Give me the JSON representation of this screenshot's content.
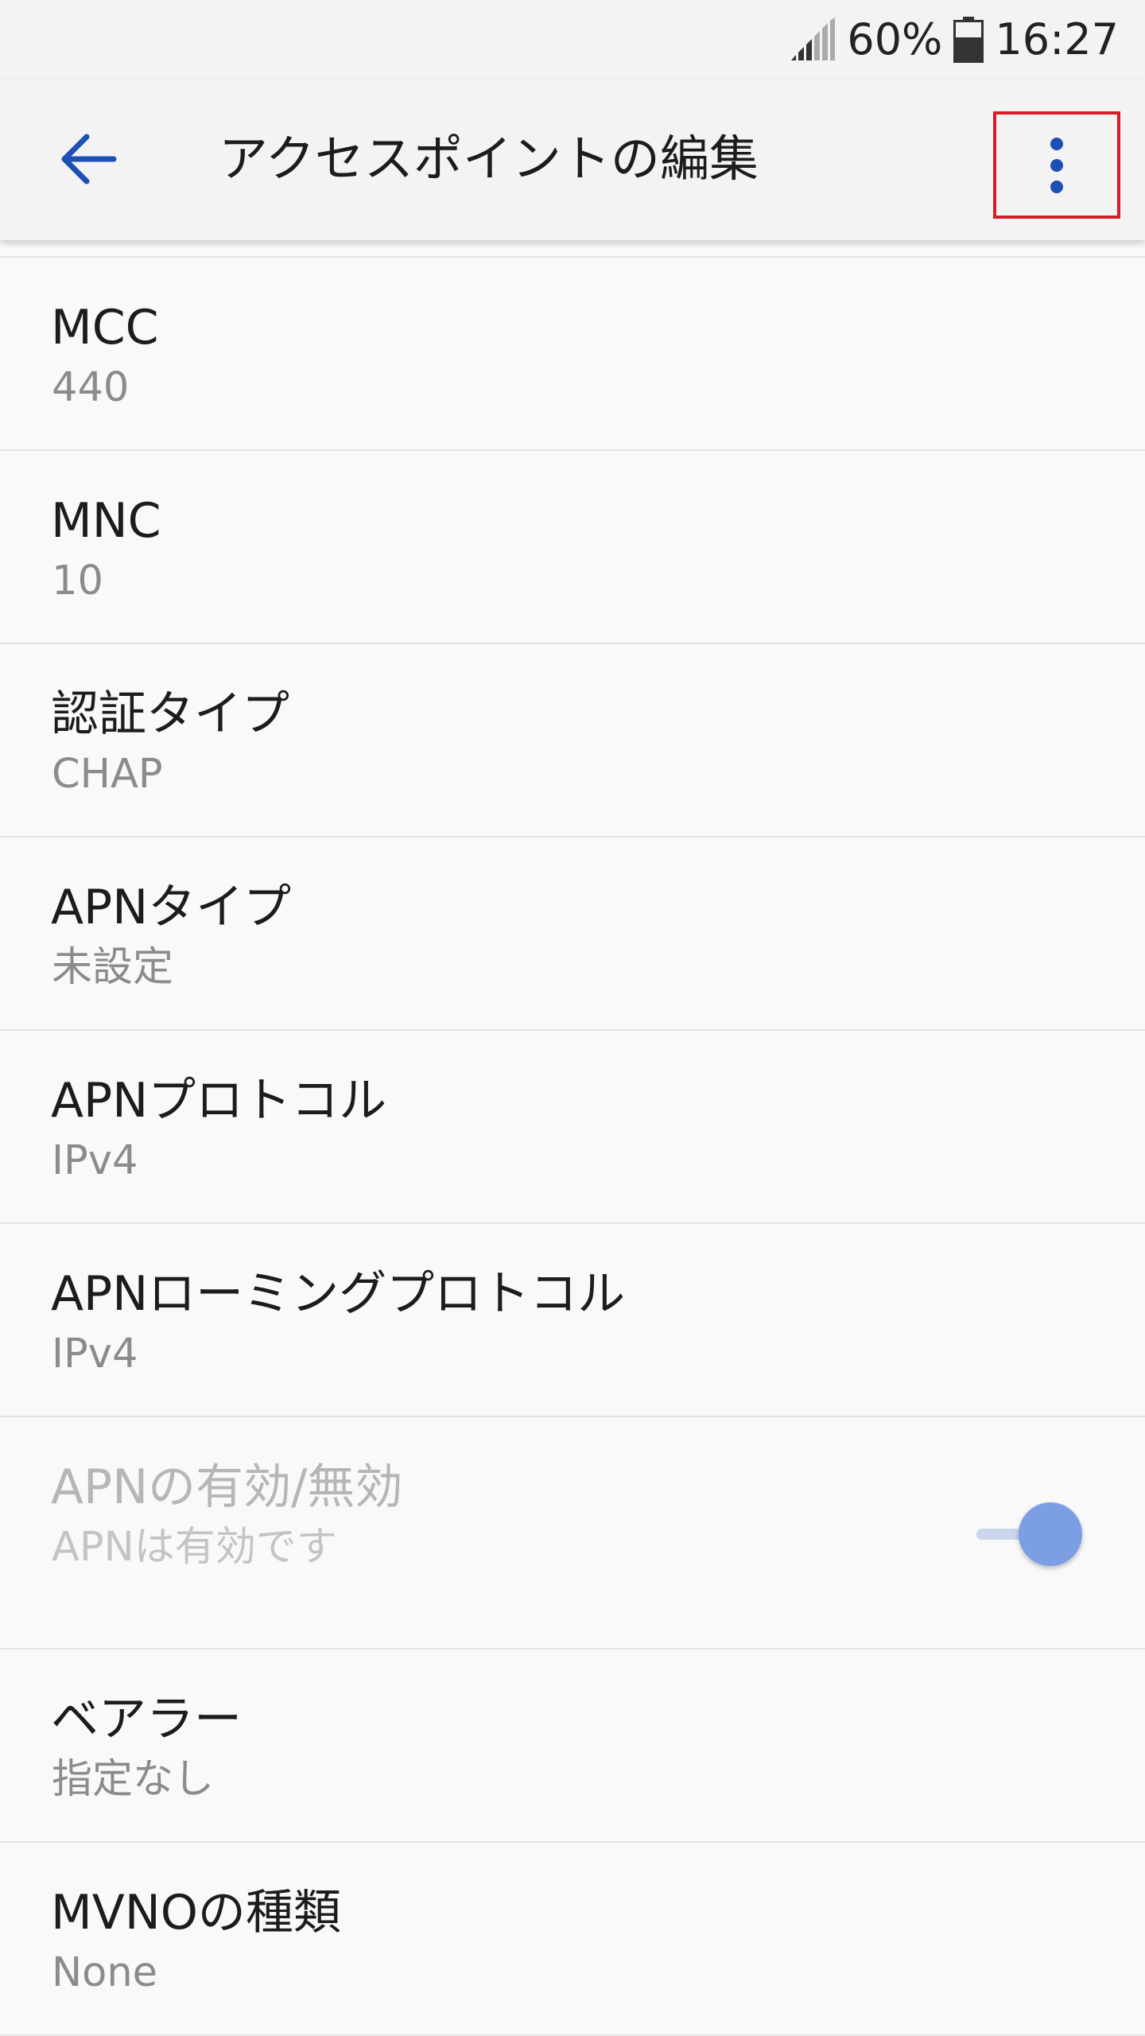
{
  "status_bar": {
    "battery_percent": "60%",
    "time": "16:27",
    "icons": [
      "signal-icon",
      "battery-icon"
    ]
  },
  "app_bar": {
    "title": "アクセスポイントの編集",
    "back_icon": "arrow-back-icon",
    "more_icon": "more-vert-icon"
  },
  "colors": {
    "accent": "#1e50b4",
    "highlight_box": "#d81c2a",
    "toggle_thumb": "#7c9ee3"
  },
  "settings": [
    {
      "title": "MCC",
      "summary": "440"
    },
    {
      "title": "MNC",
      "summary": "10"
    },
    {
      "title": "認証タイプ",
      "summary": "CHAP"
    },
    {
      "title": "APNタイプ",
      "summary": "未設定"
    },
    {
      "title": "APNプロトコル",
      "summary": "IPv4"
    },
    {
      "title": "APNローミングプロトコル",
      "summary": "IPv4"
    },
    {
      "title": "APNの有効/無効",
      "summary": "APNは有効です",
      "toggle_on": true,
      "enabled": false
    },
    {
      "title": "ベアラー",
      "summary": "指定なし"
    },
    {
      "title": "MVNOの種類",
      "summary": "None"
    }
  ]
}
